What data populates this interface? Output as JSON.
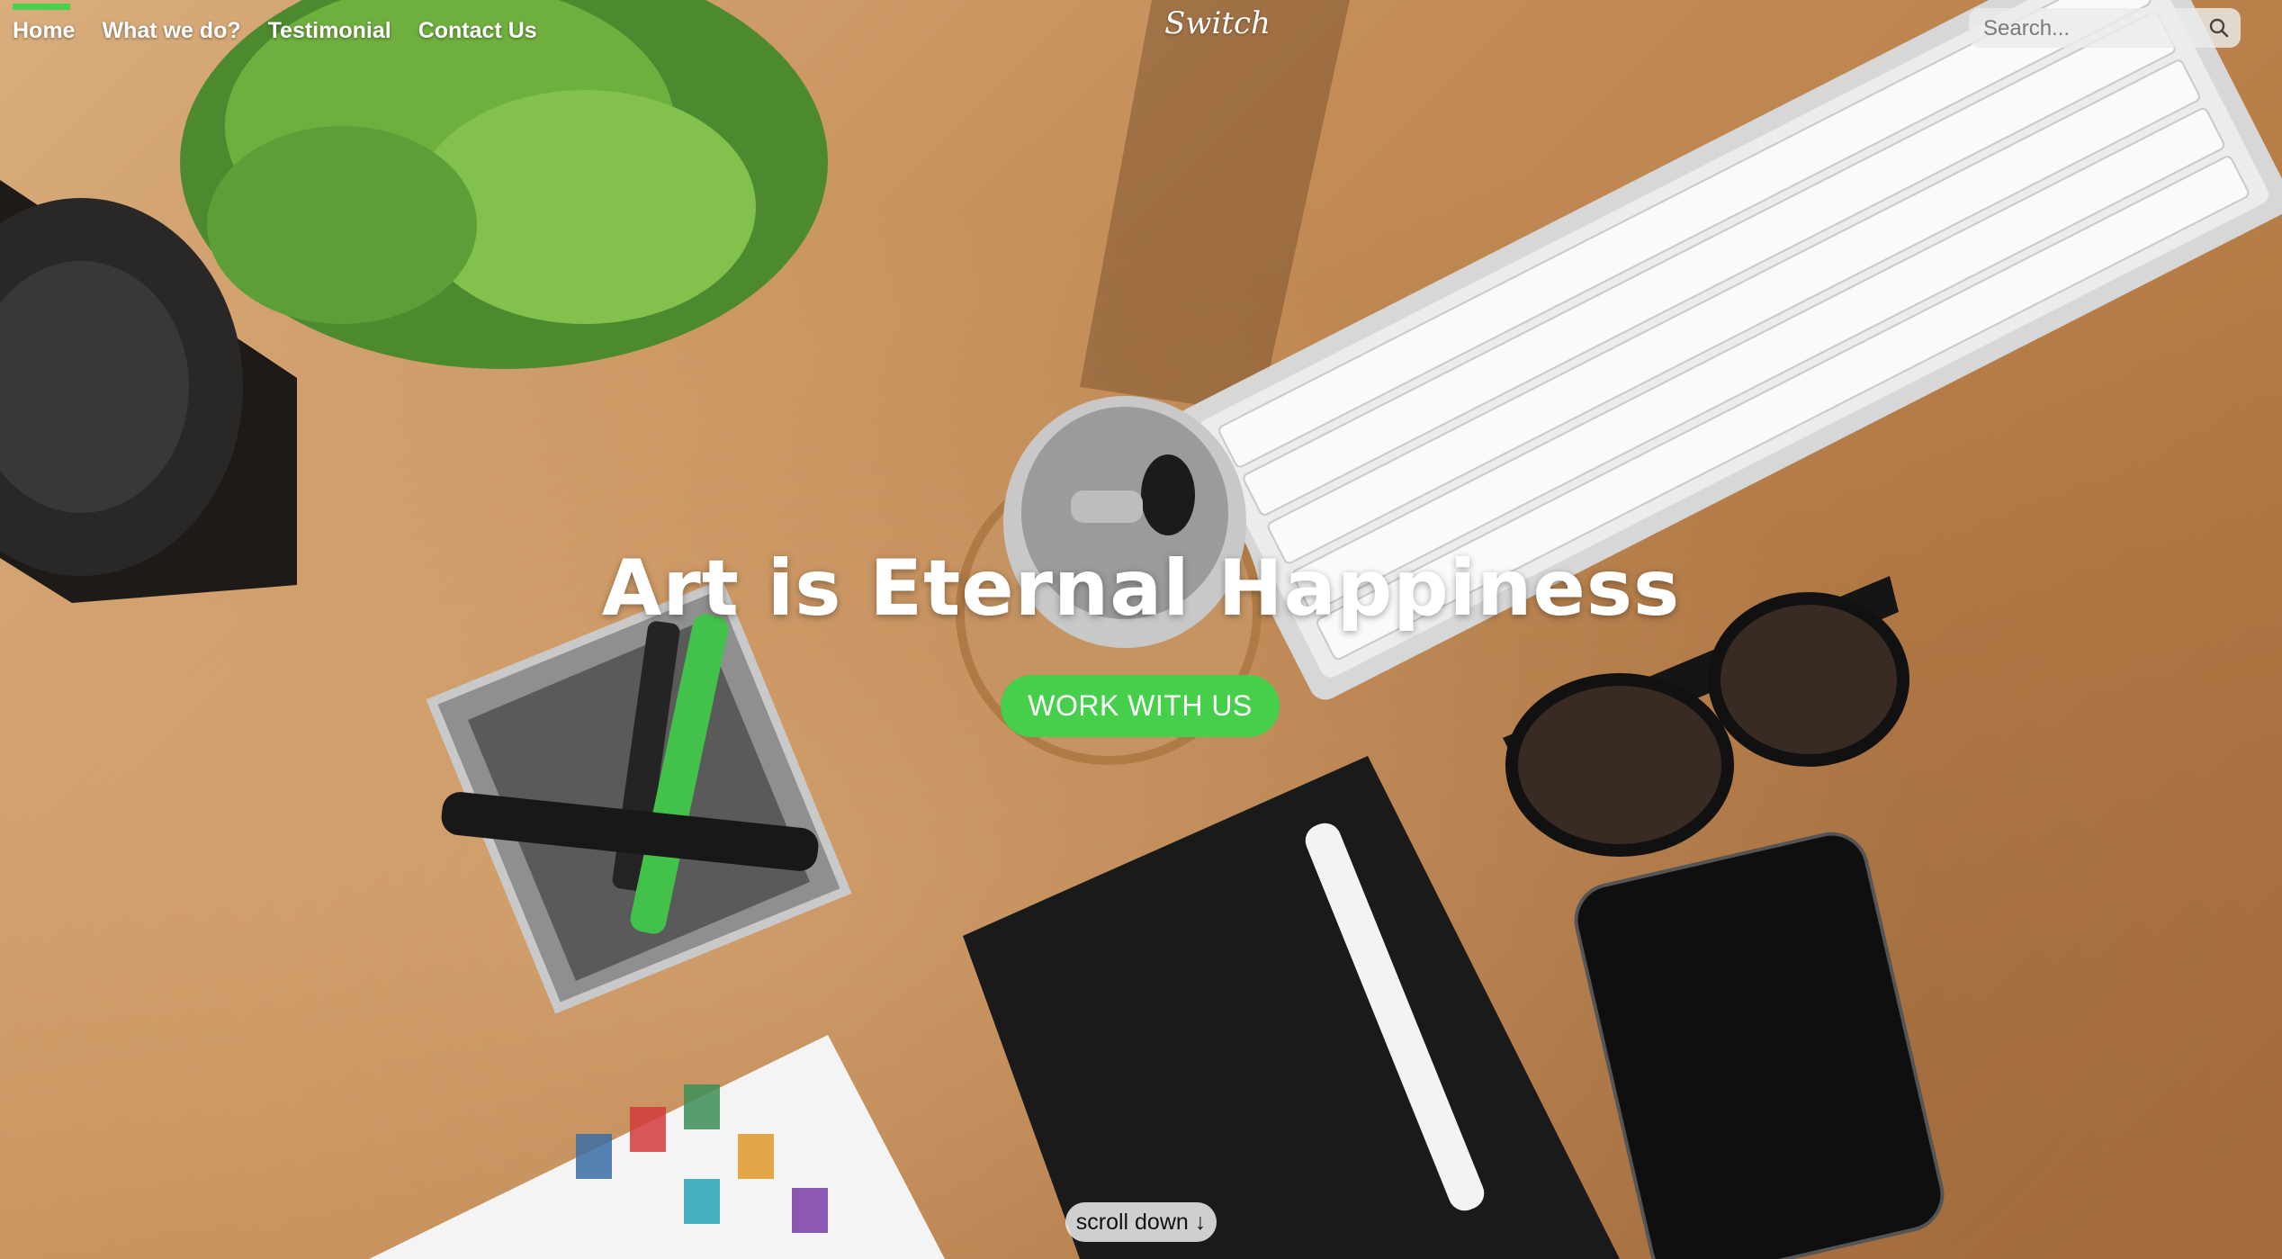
{
  "nav": {
    "items": [
      {
        "label": "Home",
        "active": true
      },
      {
        "label": "What we do?",
        "active": false
      },
      {
        "label": "Testimonial",
        "active": false
      },
      {
        "label": "Contact Us",
        "active": false
      }
    ],
    "brand": "Switch",
    "search": {
      "placeholder": "Search...",
      "icon": "search-icon"
    }
  },
  "hero": {
    "headline": "Art is Eternal Happiness",
    "cta_label": "WORK WITH US",
    "scroll_label": "scroll down ↓"
  },
  "colors": {
    "accent": "#45cf4a",
    "nav_text": "#ffffff",
    "desk": "#c48d58"
  }
}
